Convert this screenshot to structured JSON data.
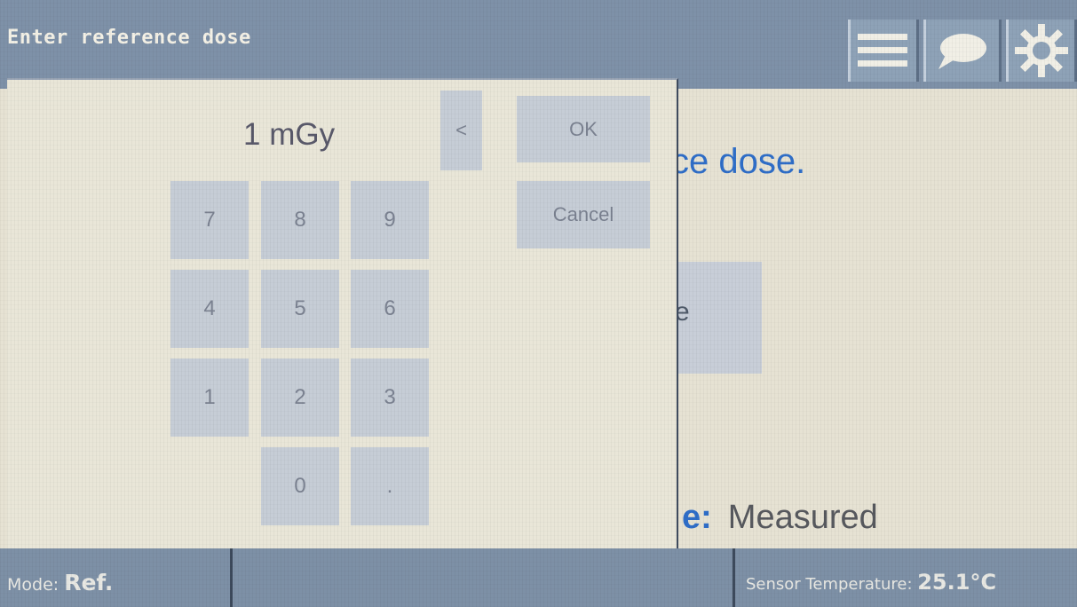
{
  "title_bar": {
    "title": "Enter reference dose",
    "icons": [
      "menu-icon",
      "chat-bubble-icon",
      "gear-icon"
    ]
  },
  "background_screen": {
    "instruction_fragment": "ce dose.",
    "button_fragment": "e",
    "dose_source_label_fragment": "e:",
    "dose_source_value": "Measured"
  },
  "keypad": {
    "display_value": "1 mGy",
    "backspace_label": "<",
    "ok_label": "OK",
    "cancel_label": "Cancel",
    "digits": {
      "k7": "7",
      "k8": "8",
      "k9": "9",
      "k4": "4",
      "k5": "5",
      "k6": "6",
      "k1": "1",
      "k2": "2",
      "k3": "3",
      "k0": "0",
      "decimal": "."
    }
  },
  "status_bar": {
    "mode_label": "Mode: ",
    "mode_value": "Ref.",
    "temperature_label": "Sensor Temperature: ",
    "temperature_value": "25.1°C"
  },
  "colors": {
    "title_bar": "#7e91a8",
    "status_bar": "#7d90a6",
    "key_fill": "#c6cdd6",
    "accent_text": "#2f6ec8",
    "screen_bg": "#e6e2d3"
  }
}
